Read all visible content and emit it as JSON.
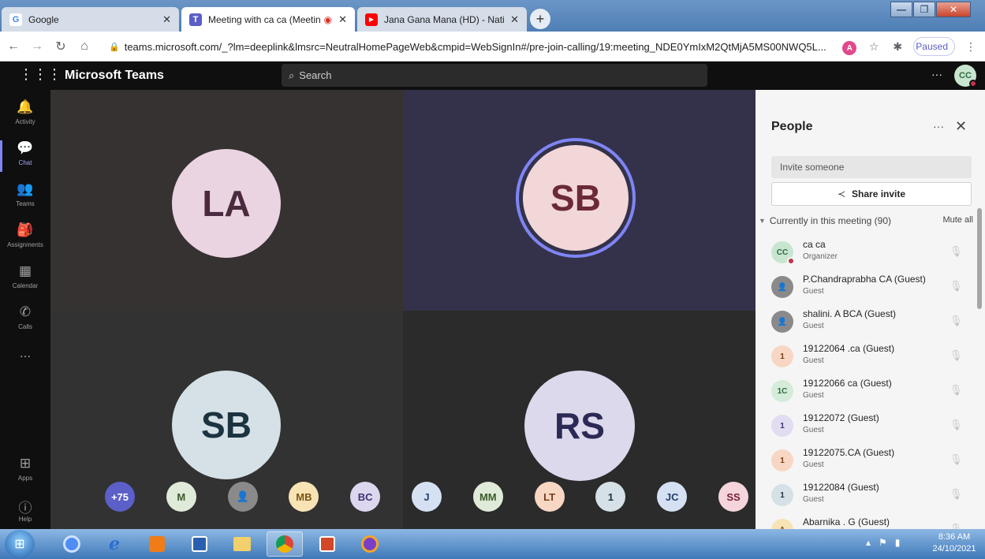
{
  "browser": {
    "tabs": [
      {
        "title": "Google",
        "icon": "G",
        "icon_color": "#4285f4",
        "active": false
      },
      {
        "title": "Meeting with ca ca (Meeting",
        "icon": "T",
        "icon_color": "#5b5fc7",
        "active": true
      },
      {
        "title": "Jana Gana Mana (HD) - National",
        "icon": "▶",
        "icon_color": "#ff0000",
        "active": false
      }
    ],
    "url": "teams.microsoft.com/_?lm=deeplink&lmsrc=NeutralHomePageWeb&cmpid=WebSignIn#/pre-join-calling/19:meeting_NDE0YmIxM2QtMjA5MS00NWQ5L...",
    "profile_initial": "A",
    "profile_status": "Paused"
  },
  "teams": {
    "app_title": "Microsoft Teams",
    "search_placeholder": "Search",
    "me_initials": "CC",
    "rail": [
      {
        "label": "Activity",
        "icon": "🔔"
      },
      {
        "label": "Chat",
        "icon": "💬"
      },
      {
        "label": "Teams",
        "icon": "👥"
      },
      {
        "label": "Assignments",
        "icon": "🎒"
      },
      {
        "label": "Calendar",
        "icon": "▦"
      },
      {
        "label": "Calls",
        "icon": "✆"
      },
      {
        "label": "...",
        "icon": ""
      },
      {
        "label": "Apps",
        "icon": "⊞"
      },
      {
        "label": "Help",
        "icon": "?"
      }
    ]
  },
  "stage": {
    "tiles": [
      {
        "initials": "LA",
        "bg": "#363232",
        "circle": "#ead4e2",
        "text": "#4a2a3e"
      },
      {
        "initials": "SB",
        "bg": "#34324a",
        "circle": "#f2d7d8",
        "text": "#6b2a35",
        "speaking": true
      },
      {
        "initials": "SB",
        "bg": "#323232",
        "circle": "#d5e1e6",
        "text": "#1c3340"
      },
      {
        "initials": "RS",
        "bg": "#2b2b2b",
        "circle": "#dcd9ec",
        "text": "#2b2a55"
      }
    ],
    "overflow": [
      {
        "label": "+75",
        "bg": "#5b5fc7",
        "fg": "#ffffff"
      },
      {
        "label": "M",
        "bg": "#dfead8",
        "fg": "#3c5a2c"
      },
      {
        "label": "👤",
        "bg": "#8a8a8a",
        "fg": "#ffffff"
      },
      {
        "label": "MB",
        "bg": "#f8e3b5",
        "fg": "#7a5410"
      },
      {
        "label": "BC",
        "bg": "#dcd7ee",
        "fg": "#3c3470"
      },
      {
        "label": "J",
        "bg": "#d5e1f2",
        "fg": "#24406e"
      },
      {
        "label": "MM",
        "bg": "#dfead8",
        "fg": "#3c5a2c"
      },
      {
        "label": "LT",
        "bg": "#f7d7c4",
        "fg": "#7a3a18"
      },
      {
        "label": "1",
        "bg": "#d5e1e6",
        "fg": "#1c3340"
      },
      {
        "label": "JC",
        "bg": "#d5e1f2",
        "fg": "#24406e"
      },
      {
        "label": "SS",
        "bg": "#f5d4dc",
        "fg": "#7a2038"
      }
    ]
  },
  "people": {
    "title": "People",
    "invite_placeholder": "Invite someone",
    "share_label": "Share invite",
    "section_label": "Currently in this meeting (90)",
    "mute_all": "Mute all",
    "list": [
      {
        "avatar": "CC",
        "name": "ca ca",
        "role": "Organizer",
        "bg": "#c8e5d0",
        "fg": "#2e6a3f",
        "dot": true
      },
      {
        "avatar": "👤",
        "name": "P.Chandraprabha CA (Guest)",
        "role": "Guest",
        "bg": "#8a8a8a",
        "fg": "#ffffff"
      },
      {
        "avatar": "👤",
        "name": "shalini. A BCA (Guest)",
        "role": "Guest",
        "bg": "#8a8a8a",
        "fg": "#ffffff"
      },
      {
        "avatar": "1",
        "name": "19122064 .ca (Guest)",
        "role": "Guest",
        "bg": "#f7d7c4",
        "fg": "#7a3a18"
      },
      {
        "avatar": "1C",
        "name": "19122066 ca (Guest)",
        "role": "Guest",
        "bg": "#d4ecd9",
        "fg": "#2e6a3f"
      },
      {
        "avatar": "1",
        "name": "19122072 (Guest)",
        "role": "Guest",
        "bg": "#e1dcf0",
        "fg": "#3c3470"
      },
      {
        "avatar": "1",
        "name": "19122075.CA (Guest)",
        "role": "Guest",
        "bg": "#f7d7c4",
        "fg": "#7a3a18"
      },
      {
        "avatar": "1",
        "name": "19122084 (Guest)",
        "role": "Guest",
        "bg": "#d5e1e6",
        "fg": "#1c3340"
      },
      {
        "avatar": "A",
        "name": "Abarnika . G (Guest)",
        "role": "Guest",
        "bg": "#f8e3b5",
        "fg": "#7a5410"
      }
    ]
  },
  "taskbar": {
    "clock_time": "8:36 AM",
    "clock_date": "24/10/2021"
  }
}
